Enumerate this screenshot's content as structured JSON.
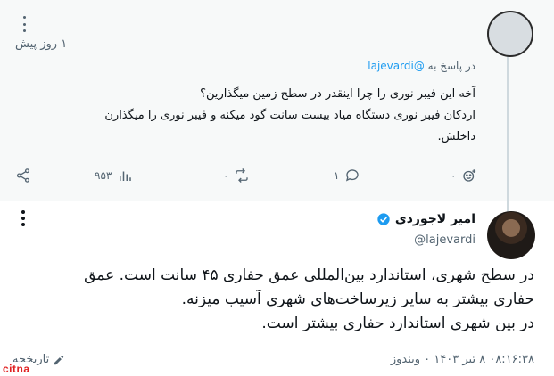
{
  "reply": {
    "time_ago": "۱ روز پیش",
    "replying_to_prefix": "در پاسخ به",
    "replying_to_handle": "@lajevardi",
    "lines": [
      "آخه این فیبر نوری را چرا اینقدر در سطح زمین میگذارین؟",
      "اردکان فیبر نوری دستگاه میاد بیست سانت گود میکنه و فیبر نوری را میگذارن",
      "داخلش."
    ],
    "actions": {
      "views": "۹۵۳",
      "retweets": "۰",
      "replies": "۱",
      "likes": "۰"
    }
  },
  "tweet": {
    "author_name": "امیر لاجوردی",
    "author_handle": "@lajevardi",
    "lines": [
      "در سطح شهری، استاندارد بین‌المللی عمق حفاری ۴۵ سانت است. عمق",
      "حفاری بیشتر به سایر زیرساخت‌های شهری آسیب میزنه.",
      "در بین شهری استاندارد حفاری بیشتر است."
    ],
    "timestamp": "۰۸:۱۶:۳۸ ۸ تیر ۱۴۰۳ ۰ ویندوز",
    "history_label": "تاریخچه"
  },
  "watermark": "citna",
  "colors": {
    "accent": "#1d9bf0",
    "muted": "#536471",
    "text": "#0f1419"
  }
}
